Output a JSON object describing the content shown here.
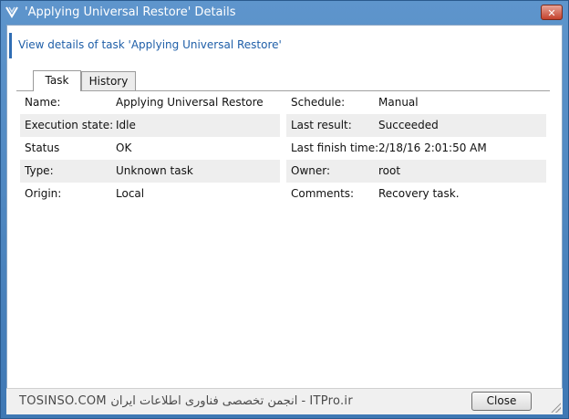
{
  "window": {
    "title": "'Applying Universal Restore' Details",
    "close_glyph": "✕"
  },
  "header": {
    "text": "View details of task 'Applying Universal Restore'"
  },
  "tabs": [
    {
      "label": "Task",
      "selected": true
    },
    {
      "label": "History",
      "selected": false
    }
  ],
  "details": {
    "rows": [
      {
        "l_label": "Name:",
        "l_value": "Applying Universal Restore",
        "r_label": "Schedule:",
        "r_value": "Manual"
      },
      {
        "l_label": "Execution state:",
        "l_value": "Idle",
        "r_label": "Last result:",
        "r_value": "Succeeded"
      },
      {
        "l_label": "Status",
        "l_value": "OK",
        "r_label": "Last finish time:",
        "r_value": "2/18/16 2:01:50 AM"
      },
      {
        "l_label": "Type:",
        "l_value": "Unknown task",
        "r_label": "Owner:",
        "r_value": "root"
      },
      {
        "l_label": "Origin:",
        "l_value": "Local",
        "r_label": "Comments:",
        "r_value": "Recovery task."
      }
    ]
  },
  "footer": {
    "watermark": "TOSINSO.COM انجمن تخصصی فناوری اطلاعات ایران - ITPro.ir",
    "close_label": "Close"
  },
  "icons": {
    "app": "acronis-logo-icon",
    "close": "close-icon"
  },
  "colors": {
    "titlebar": "#5e95cc",
    "accent": "#2f6db4",
    "close_button": "#c4412c"
  }
}
